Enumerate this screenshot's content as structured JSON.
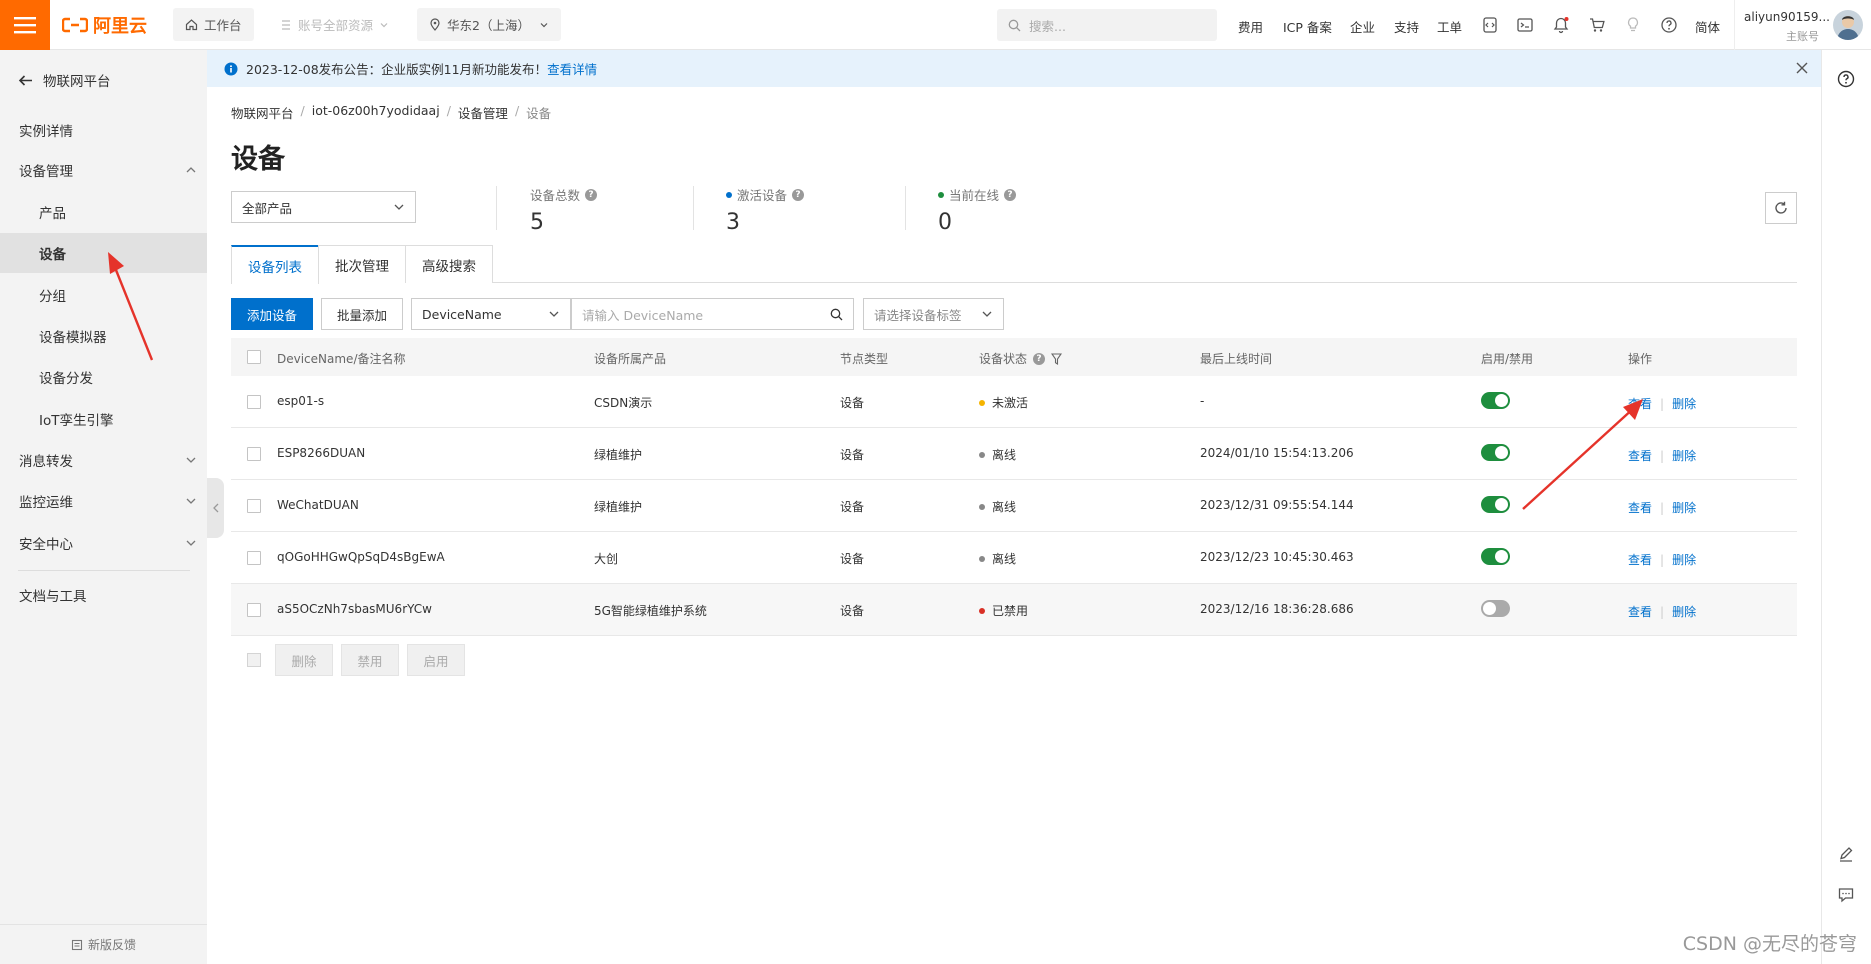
{
  "topbar": {
    "workbench": "工作台",
    "account_resources": "账号全部资源",
    "region": "华东2（上海）",
    "search_placeholder": "搜索...",
    "links": [
      "费用",
      "ICP 备案",
      "企业",
      "支持",
      "工单"
    ],
    "lang": "简体",
    "user_name": "aliyun90159...",
    "user_role": "主账号"
  },
  "sidebar": {
    "back_label": "物联网平台",
    "items": [
      {
        "label": "实例详情"
      },
      {
        "label": "设备管理"
      },
      {
        "label": "产品"
      },
      {
        "label": "设备"
      },
      {
        "label": "分组"
      },
      {
        "label": "设备模拟器"
      },
      {
        "label": "设备分发"
      },
      {
        "label": "IoT孪生引擎"
      },
      {
        "label": "消息转发"
      },
      {
        "label": "监控运维"
      },
      {
        "label": "安全中心"
      },
      {
        "label": "文档与工具"
      }
    ],
    "feedback": "新版反馈"
  },
  "notice": {
    "text": "2023-12-08发布公告：企业版实例11月新功能发布！",
    "link": "查看详情"
  },
  "breadcrumb": [
    "物联网平台",
    "iot-06z00h7yodidaaj",
    "设备管理",
    "设备"
  ],
  "page_title": "设备",
  "product_filter": "全部产品",
  "stats": [
    {
      "label": "设备总数",
      "value": "5"
    },
    {
      "label": "激活设备",
      "value": "3"
    },
    {
      "label": "当前在线",
      "value": "0"
    }
  ],
  "tabs": [
    "设备列表",
    "批次管理",
    "高级搜索"
  ],
  "toolbar": {
    "add_device": "添加设备",
    "batch_add": "批量添加",
    "field_select": "DeviceName",
    "search_placeholder": "请输入 DeviceName",
    "tag_select": "请选择设备标签"
  },
  "table": {
    "columns": [
      "DeviceName/备注名称",
      "设备所属产品",
      "节点类型",
      "设备状态",
      "最后上线时间",
      "启用/禁用",
      "操作"
    ],
    "rows": [
      {
        "name": "esp01-s",
        "product": "CSDN演示",
        "node": "设备",
        "status": "未激活",
        "status_color": "#f5b400",
        "last_online": "-",
        "enabled": true
      },
      {
        "name": "ESP8266DUAN",
        "product": "绿植维护",
        "node": "设备",
        "status": "离线",
        "status_color": "#888888",
        "last_online": "2024/01/10 15:54:13.206",
        "enabled": true
      },
      {
        "name": "WeChatDUAN",
        "product": "绿植维护",
        "node": "设备",
        "status": "离线",
        "status_color": "#888888",
        "last_online": "2023/12/31 09:55:54.144",
        "enabled": true
      },
      {
        "name": "qOGoHHGwQpSqD4sBgEwA",
        "product": "大创",
        "node": "设备",
        "status": "离线",
        "status_color": "#888888",
        "last_online": "2023/12/23 10:45:30.463",
        "enabled": true
      },
      {
        "name": "aS5OCzNh7sbasMU6rYCw",
        "product": "5G智能绿植维护系统",
        "node": "设备",
        "status": "已禁用",
        "status_color": "#d93026",
        "last_online": "2023/12/16 18:36:28.686",
        "enabled": false
      }
    ],
    "op_view": "查看",
    "op_delete": "删除"
  },
  "bulk_actions": [
    "删除",
    "禁用",
    "启用"
  ],
  "watermark": "CSDN @无尽的苍穹",
  "colors": {
    "brand": "#ff6a00",
    "primary": "#0070cc",
    "toggle_on": "#1e8e3e",
    "annotation": "#e5332a"
  },
  "icons": [
    "menu-icon",
    "aliyun-logo-icon",
    "home-icon",
    "list-icon",
    "location-icon",
    "search-icon",
    "bell-icon",
    "cart-icon",
    "help-icon",
    "info-icon",
    "close-icon",
    "refresh-icon",
    "edit-icon",
    "chat-icon"
  ]
}
